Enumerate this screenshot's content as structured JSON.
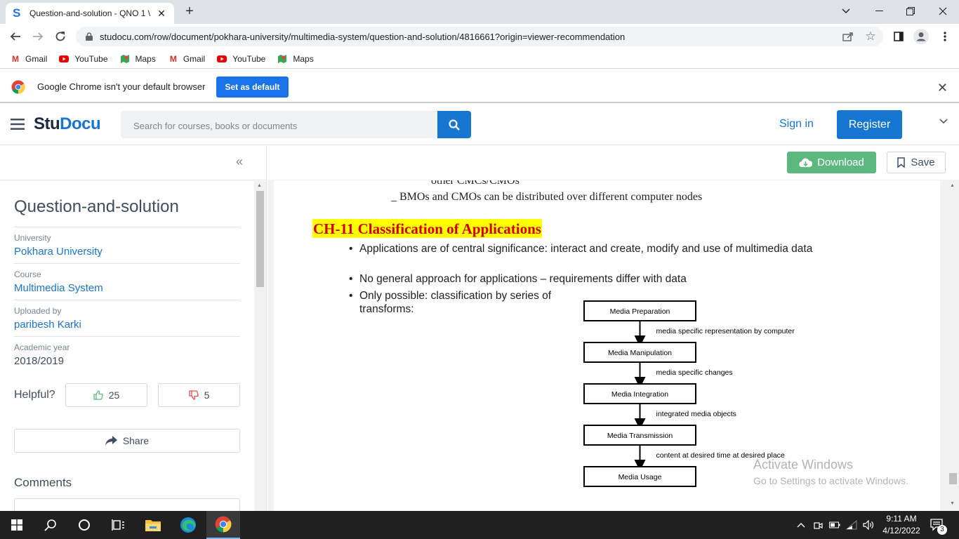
{
  "browser": {
    "tab_title": "Question-and-solution - QNO 1 \\",
    "tab_favicon": "S",
    "new_tab": "+",
    "url": "studocu.com/row/document/pokhara-university/multimedia-system/question-and-solution/4816661?origin=viewer-recommendation",
    "bookmarks": [
      {
        "label": "Gmail",
        "icon": "gmail-icon"
      },
      {
        "label": "YouTube",
        "icon": "youtube-icon"
      },
      {
        "label": "Maps",
        "icon": "maps-icon"
      },
      {
        "label": "Gmail",
        "icon": "gmail-icon"
      },
      {
        "label": "YouTube",
        "icon": "youtube-icon"
      },
      {
        "label": "Maps",
        "icon": "maps-icon"
      }
    ],
    "infobar_text": "Google Chrome isn't your default browser",
    "infobar_button": "Set as default"
  },
  "header": {
    "logo_a": "Stu",
    "logo_b": "Docu",
    "search_placeholder": "Search for courses, books or documents",
    "signin": "Sign in",
    "register": "Register"
  },
  "sidebar": {
    "collapse": "«",
    "title": "Question-and-solution",
    "meta": [
      {
        "label": "University",
        "value": "Pokhara University"
      },
      {
        "label": "Course",
        "value": "Multimedia System"
      },
      {
        "label": "Uploaded by",
        "value": "paribesh Karki"
      },
      {
        "label": "Academic year",
        "value": "2018/2019"
      }
    ],
    "helpful": "Helpful?",
    "upvotes": "25",
    "downvotes": "5",
    "share": "Share",
    "comments": "Comments"
  },
  "viewer": {
    "download": "Download",
    "save": "Save",
    "lines": [
      "other CMCs/CMOs",
      "_ BMOs and CMOs can be distributed over different computer nodes"
    ],
    "heading": "CH-11 Classification of Applications",
    "bullets": [
      "Applications are of central significance: interact and create, modify and use of multimedia data",
      "No general approach for applications – requirements differ with data",
      "Only possible: classification by series of transforms:"
    ],
    "flow_boxes": [
      "Media Preparation",
      "Media Manipulation",
      "Media Integration",
      "Media Transmission",
      "Media Usage"
    ],
    "flow_labels": [
      "media specific representation by computer",
      "media specific changes",
      "integrated media objects",
      "content at desired time at desired place"
    ]
  },
  "watermark": {
    "line1": "Activate Windows",
    "line2": "Go to Settings to activate Windows."
  },
  "taskbar": {
    "time": "9:11 AM",
    "date": "4/12/2022",
    "notifications": "3"
  },
  "colors": {
    "brand_blue": "#1776d1",
    "download_green": "#5cb87f",
    "heading_red": "#d00000",
    "heading_highlight": "#ffff00"
  }
}
